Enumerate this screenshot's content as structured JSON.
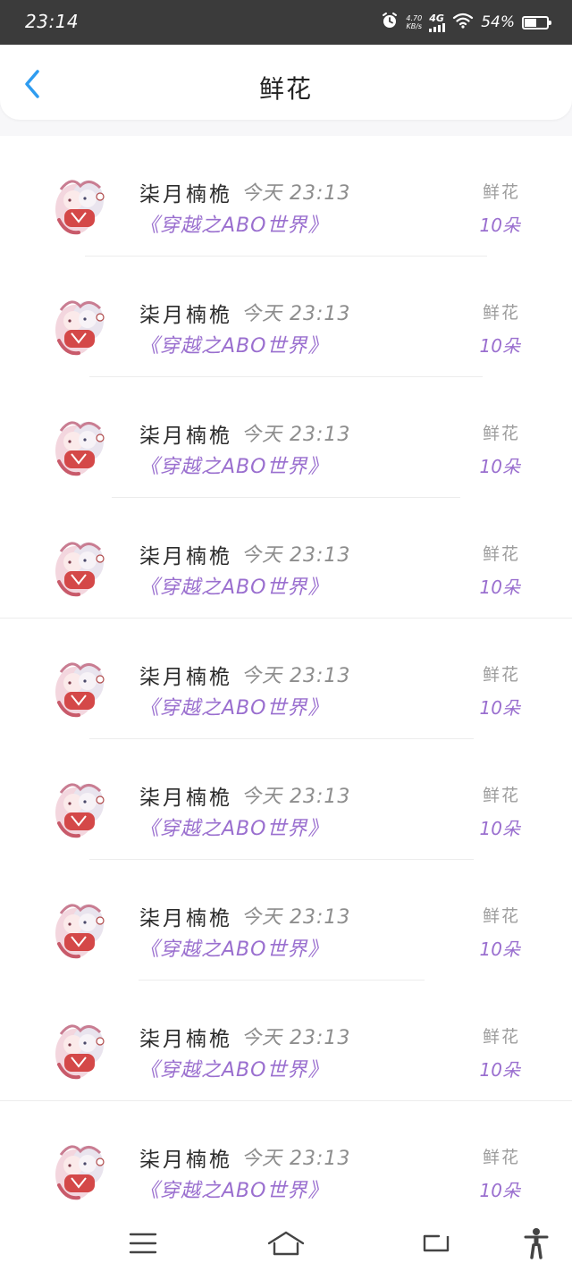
{
  "status_bar": {
    "time": "23:14",
    "net_speed_value": "4.70",
    "net_speed_unit": "KB/s",
    "network": "4G",
    "battery_percent": "54%",
    "battery_level": 0.54
  },
  "header": {
    "title": "鲜花",
    "back_icon": "chevron-left-icon"
  },
  "colors": {
    "accent": "#2e9cf0",
    "book_text": "#9a6fcf",
    "status_bar_bg": "#3b3b3b"
  },
  "records": [
    {
      "name": "柒月楠桅",
      "time": "今天 23:13",
      "book": "《穿越之ABO世界》",
      "gift_type": "鲜花",
      "gift_count": "10朵"
    },
    {
      "name": "柒月楠桅",
      "time": "今天 23:13",
      "book": "《穿越之ABO世界》",
      "gift_type": "鲜花",
      "gift_count": "10朵"
    },
    {
      "name": "柒月楠桅",
      "time": "今天 23:13",
      "book": "《穿越之ABO世界》",
      "gift_type": "鲜花",
      "gift_count": "10朵"
    },
    {
      "name": "柒月楠桅",
      "time": "今天 23:13",
      "book": "《穿越之ABO世界》",
      "gift_type": "鲜花",
      "gift_count": "10朵"
    },
    {
      "name": "柒月楠桅",
      "time": "今天 23:13",
      "book": "《穿越之ABO世界》",
      "gift_type": "鲜花",
      "gift_count": "10朵"
    },
    {
      "name": "柒月楠桅",
      "time": "今天 23:13",
      "book": "《穿越之ABO世界》",
      "gift_type": "鲜花",
      "gift_count": "10朵"
    },
    {
      "name": "柒月楠桅",
      "time": "今天 23:13",
      "book": "《穿越之ABO世界》",
      "gift_type": "鲜花",
      "gift_count": "10朵"
    },
    {
      "name": "柒月楠桅",
      "time": "今天 23:13",
      "book": "《穿越之ABO世界》",
      "gift_type": "鲜花",
      "gift_count": "10朵"
    },
    {
      "name": "柒月楠桅",
      "time": "今天 23:13",
      "book": "《穿越之ABO世界》",
      "gift_type": "鲜花",
      "gift_count": "10朵"
    }
  ],
  "nav_bar": {
    "icons": [
      "menu-icon",
      "home-icon",
      "back-icon",
      "accessibility-icon"
    ]
  }
}
